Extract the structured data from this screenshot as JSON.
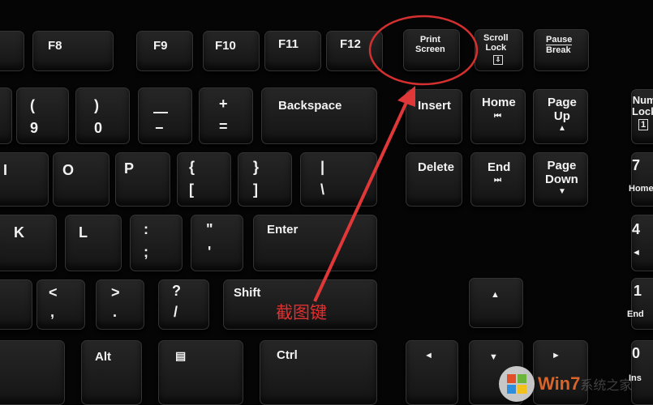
{
  "keys": {
    "f8": "F8",
    "f9": "F9",
    "f10": "F10",
    "f11": "F11",
    "f12": "F12",
    "print_screen": "Print\nScreen",
    "scroll_lock": "Scroll\nLock",
    "pause": "Pause",
    "break": "Break",
    "paren_open": "(",
    "nine": "9",
    "paren_close": ")",
    "zero": "0",
    "underscore": "—",
    "minus": "−",
    "plus": "+",
    "equals": "=",
    "backspace": "Backspace",
    "insert": "Insert",
    "home": "Home",
    "page_up": "Page\nUp",
    "num_lock": "Num\nLock",
    "num_lock_sym": "1",
    "i": "I",
    "o": "O",
    "p": "P",
    "brace_open": "{",
    "bracket_open": "[",
    "brace_close": "}",
    "bracket_close": "]",
    "pipe": "|",
    "backslash": "\\",
    "delete": "Delete",
    "end": "End",
    "page_down": "Page\nDown",
    "num7": "7",
    "num7_sub": "Home",
    "k": "K",
    "l": "L",
    "colon": ":",
    "semicolon": ";",
    "quote": "\"",
    "apos": "'",
    "enter": "Enter",
    "num4": "4",
    "num4_sub": "◄",
    "lt": "<",
    "comma": ",",
    "gt": ">",
    "period": ".",
    "question": "?",
    "slash": "/",
    "shift": "Shift",
    "num1": "1",
    "num1_sub": "End",
    "alt": "Alt",
    "ctrl": "Ctrl",
    "num0": "0",
    "num0_sub": "Ins"
  },
  "annotation": {
    "label": "截图键",
    "color": "#e03030"
  },
  "watermark": {
    "text": "Win7",
    "text2": "系统之家"
  }
}
